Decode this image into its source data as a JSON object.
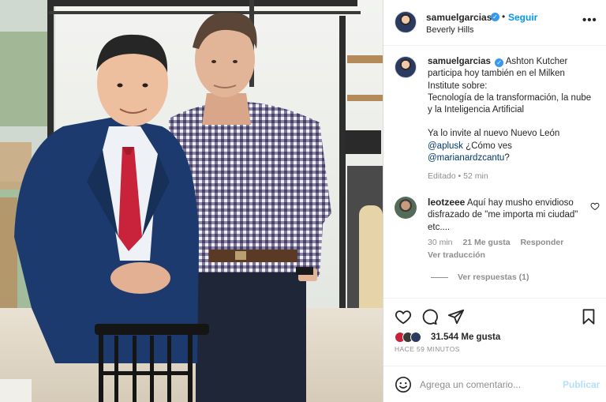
{
  "post": {
    "author": "samuelgarcias",
    "follow_label": "Seguir",
    "separator": "•",
    "location": "Beverly Hills",
    "more_icon": "more-horizontal-icon",
    "verified_glyph": "✓"
  },
  "caption": {
    "author": "samuelgarcias",
    "line1": "Ashton Kutcher participa hoy también en el Milken Institute sobre:",
    "line2": "Tecnología de la transformación, la nube y la Inteligencia Artificial",
    "line3": "Ya lo invite al nuevo Nuevo León",
    "mention1": "@aplusk",
    "text_after_mention1": " ¿Cómo ves",
    "mention2": "@marianardzcantu",
    "text_after_mention2": "?",
    "edited": "Editado",
    "edited_sep": "•",
    "edited_time": "52 min"
  },
  "comment": {
    "author": "leotzeee",
    "text": "Aquí hay musho envidioso disfrazado de \"me importa mi ciudad\" etc....",
    "time": "30 min",
    "likes": "21 Me gusta",
    "reply": "Responder",
    "translate": "Ver traducción",
    "view_replies": "Ver respuestas (1)"
  },
  "actions": {
    "likes_count": "31.544 Me gusta",
    "timestamp": "HACE 59 MINUTOS"
  },
  "composer": {
    "placeholder": "Agrega un comentario...",
    "publish": "Publicar"
  },
  "colors": {
    "accent": "#0095f6",
    "link": "#00376b",
    "muted": "#8e8e8e",
    "publish_disabled": "#b2dffc",
    "verified": "#3897f0"
  }
}
